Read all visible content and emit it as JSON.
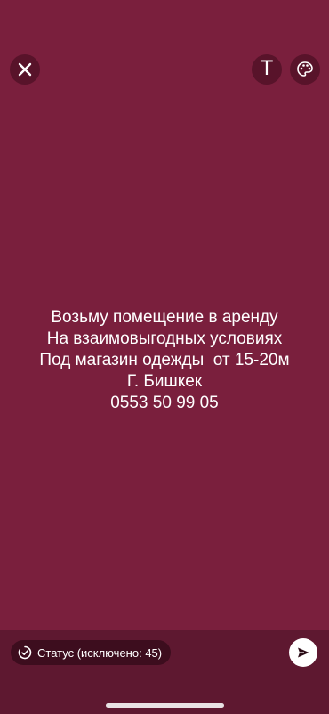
{
  "toolbar": {
    "close_icon": "close-icon",
    "text_tool_label": "T",
    "palette_icon": "palette-icon"
  },
  "message": {
    "lines": [
      "Возьму помещение в аренду",
      "На взаимовыгодных условиях",
      "Под магазин одежды  от 15-20м",
      "Г. Бишкек",
      "0553 50 99 05"
    ]
  },
  "footer": {
    "status_label": "Статус (исключено: 45)",
    "status_icon": "status-ring-icon",
    "send_icon": "send-icon"
  },
  "colors": {
    "background": "#7a1f3d",
    "footer_background": "#5e1830",
    "text": "#ffffff"
  }
}
